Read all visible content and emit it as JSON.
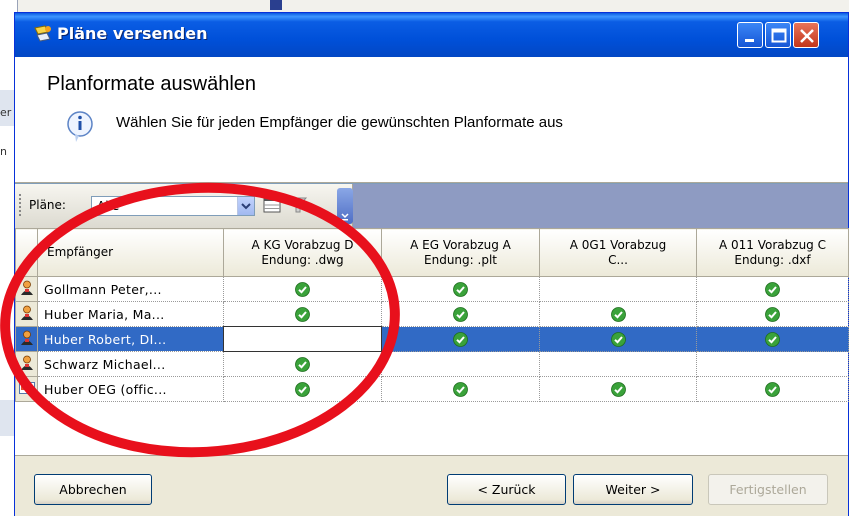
{
  "background": {
    "partial_text": [
      "er",
      "n"
    ]
  },
  "dialog": {
    "title": "Pläne versenden",
    "header": {
      "title": "Planformate auswählen",
      "description": "Wählen Sie für jeden Empfänger die gewünschten Planformate aus"
    },
    "toolbar": {
      "plans_label": "Pläne:",
      "plans_value": "Alle"
    },
    "grid": {
      "columns": [
        {
          "title": "Empfänger"
        },
        {
          "line1": "A KG Vorabzug D",
          "line2": "Endung: .dwg"
        },
        {
          "line1": "A EG Vorabzug A",
          "line2": "Endung: .plt"
        },
        {
          "line1": "A 0G1 Vorabzug",
          "line2": "C..."
        },
        {
          "line1": "A 011 Vorabzug C",
          "line2": "Endung: .dxf"
        }
      ],
      "rows": [
        {
          "icon": "person-icon",
          "name": "Gollmann Peter,...",
          "checks": [
            true,
            true,
            false,
            true
          ],
          "selected": false
        },
        {
          "icon": "person-icon",
          "name": "Huber Maria, Ma...",
          "checks": [
            true,
            true,
            true,
            true
          ],
          "selected": false
        },
        {
          "icon": "person-icon",
          "name": "Huber Robert, DI...",
          "checks": [
            false,
            true,
            true,
            true
          ],
          "selected": true
        },
        {
          "icon": "person-icon",
          "name": "Schwarz Michael...",
          "checks": [
            true,
            false,
            false,
            false
          ],
          "selected": false
        },
        {
          "icon": "business-card-icon",
          "name": "Huber OEG (offic...",
          "checks": [
            true,
            true,
            true,
            true
          ],
          "selected": false
        }
      ]
    },
    "buttons": {
      "abort": "Abbrechen",
      "back": "< Zurück",
      "next": "Weiter >",
      "finish": "Fertigstellen"
    }
  },
  "colors": {
    "title_bar": "#0050d9",
    "selection": "#316ac5",
    "check_green": "#3aa23a",
    "annotation": "#e8101c"
  }
}
